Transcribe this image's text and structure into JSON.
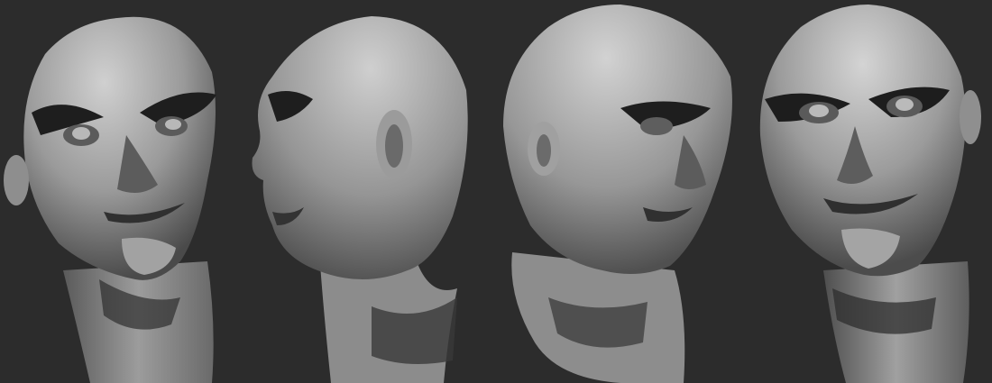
{
  "scene": {
    "background_color": "#2c2c2c",
    "clay_color": "#8a8a8a",
    "views": [
      {
        "name": "front-three-quarter-view"
      },
      {
        "name": "left-profile-view"
      },
      {
        "name": "right-three-quarter-view"
      },
      {
        "name": "front-view"
      }
    ]
  }
}
